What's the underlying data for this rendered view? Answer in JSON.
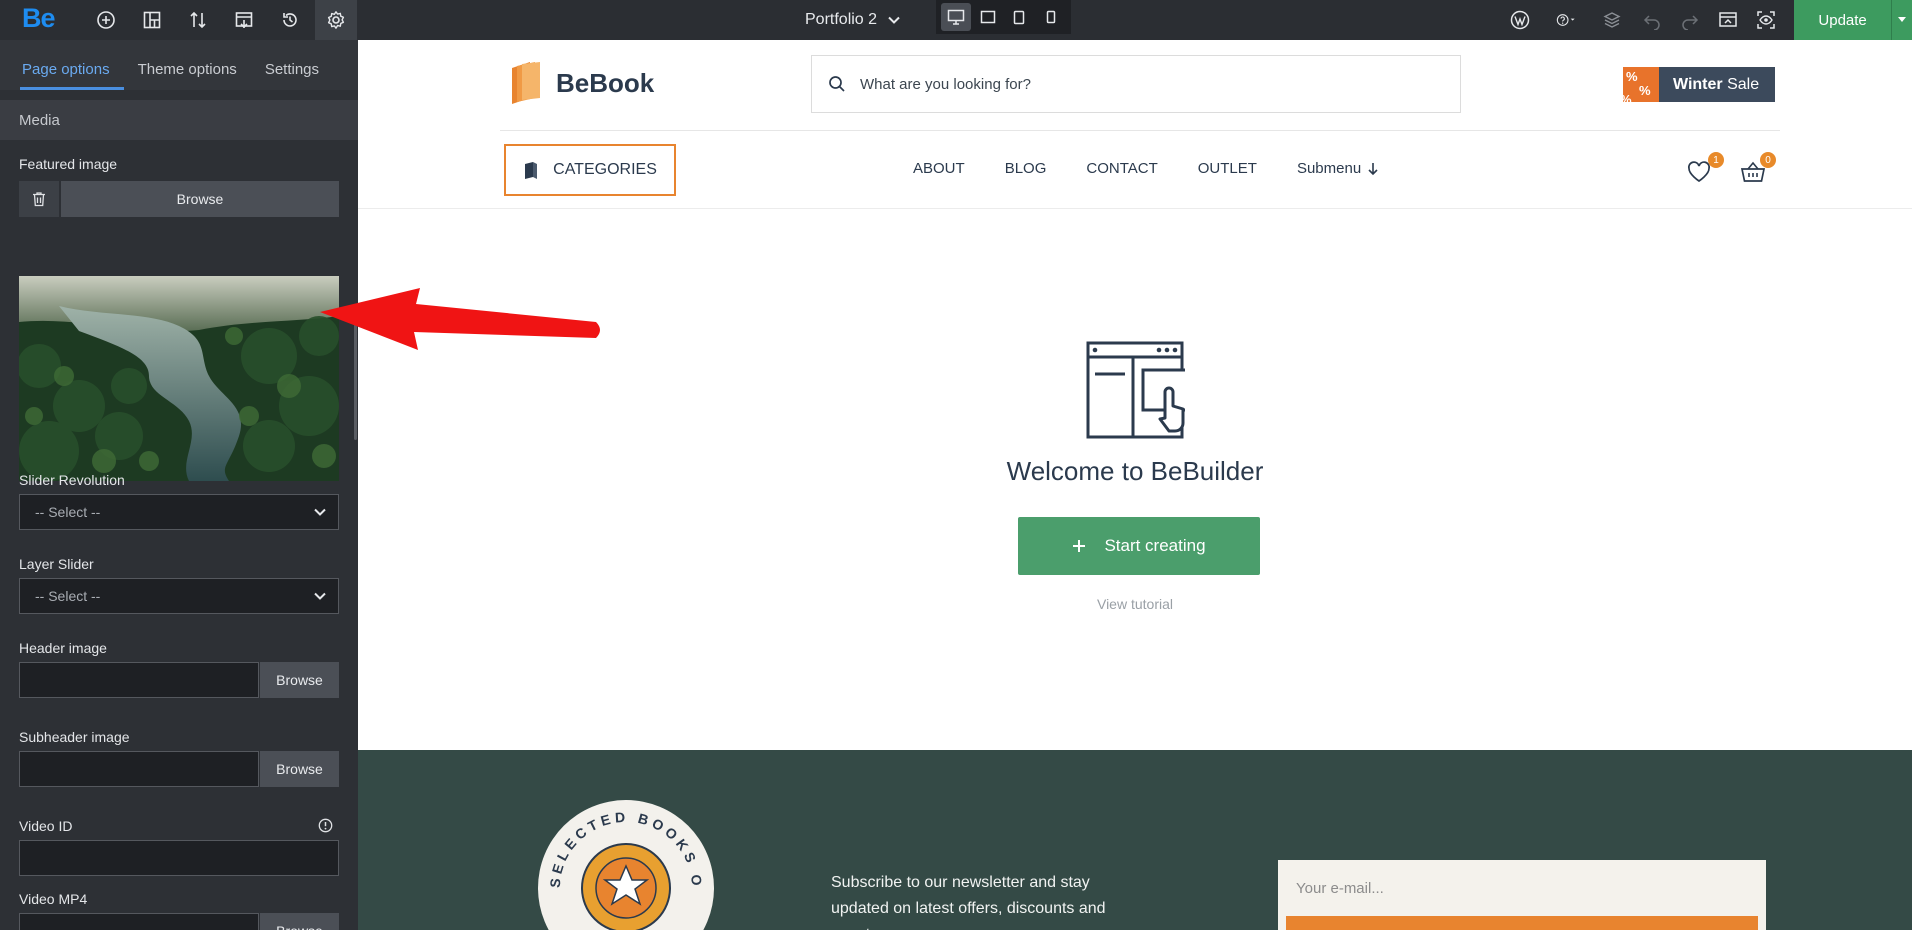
{
  "topbar": {
    "logo": "Be",
    "tools": [
      {
        "name": "add-icon"
      },
      {
        "name": "layout-icon"
      },
      {
        "name": "sort-icon"
      },
      {
        "name": "template-icon"
      },
      {
        "name": "history-icon"
      },
      {
        "name": "settings-icon"
      }
    ],
    "page_title": "Portfolio 2",
    "devices": [
      "desktop",
      "laptop",
      "tablet",
      "mobile"
    ],
    "update_label": "Update"
  },
  "sidebar": {
    "tabs": [
      {
        "label": "Page options",
        "active": true
      },
      {
        "label": "Theme options"
      },
      {
        "label": "Settings"
      }
    ],
    "section": "Media",
    "featured_image": {
      "label": "Featured image",
      "browse": "Browse"
    },
    "slider_revolution": {
      "label": "Slider Revolution",
      "value": "-- Select --"
    },
    "layer_slider": {
      "label": "Layer Slider",
      "value": "-- Select --"
    },
    "header_image": {
      "label": "Header image",
      "browse": "Browse"
    },
    "subheader_image": {
      "label": "Subheader image",
      "browse": "Browse"
    },
    "video_id": {
      "label": "Video ID"
    },
    "video_mp4": {
      "label": "Video MP4",
      "browse": "Browse"
    }
  },
  "site": {
    "logo_name": "BeBook",
    "search_placeholder": "What are you looking for?",
    "sale": {
      "bold": "Winter",
      "rest": " Sale"
    },
    "categories_label": "CATEGORIES",
    "nav": [
      "ABOUT",
      "BLOG",
      "CONTACT",
      "OUTLET",
      "Submenu"
    ],
    "wishlist_count": "1",
    "cart_count": "0",
    "welcome_title": "Welcome to BeBuilder",
    "start_label": "Start creating",
    "tutorial_label": "View tutorial",
    "footer": {
      "stamp_text": "SELECTED BOOKS ON THE",
      "newsletter_text": "Subscribe to our newsletter and stay updated on latest offers, discounts and events near you",
      "email_placeholder": "Your e-mail..."
    }
  },
  "colors": {
    "accent_blue": "#1e8cf0",
    "update_green": "#3d9b5f",
    "brand_orange": "#e8842f",
    "start_green": "#4b9e6c",
    "footer_green": "#344a46",
    "annotation_red": "#f01414"
  }
}
